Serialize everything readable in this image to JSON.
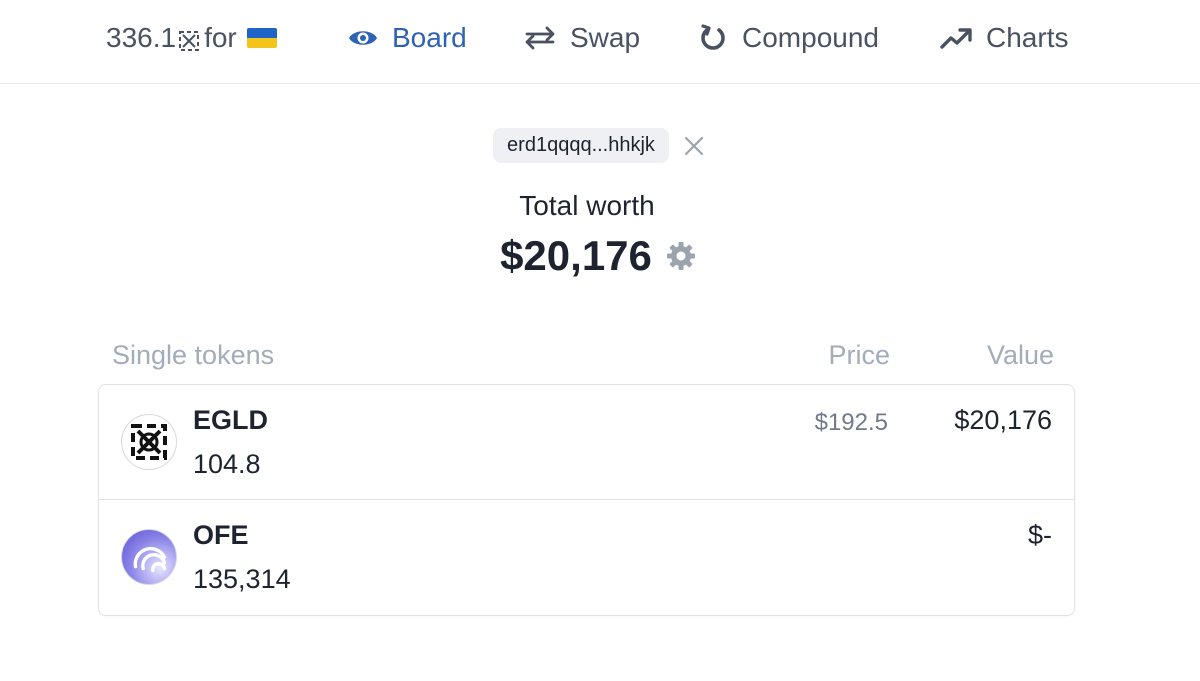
{
  "nav": {
    "brand_prefix": "336.1",
    "brand_suffix": "for",
    "board_label": "Board",
    "swap_label": "Swap",
    "compound_label": "Compound",
    "charts_label": "Charts",
    "active_color": "#2f62b3"
  },
  "wallet": {
    "address": "erd1qqqq...hhkjk"
  },
  "summary": {
    "total_label": "Total worth",
    "total_value": "$20,176"
  },
  "table": {
    "headers": {
      "name": "Single tokens",
      "price": "Price",
      "value": "Value"
    },
    "rows": [
      {
        "symbol": "EGLD",
        "amount": "104.8",
        "price": "$192.5",
        "value": "$20,176",
        "icon": "egld-logo-icon"
      },
      {
        "symbol": "OFE",
        "amount": "135,314",
        "price": "",
        "value": "$-",
        "icon": "ofe-logo-icon"
      }
    ]
  }
}
